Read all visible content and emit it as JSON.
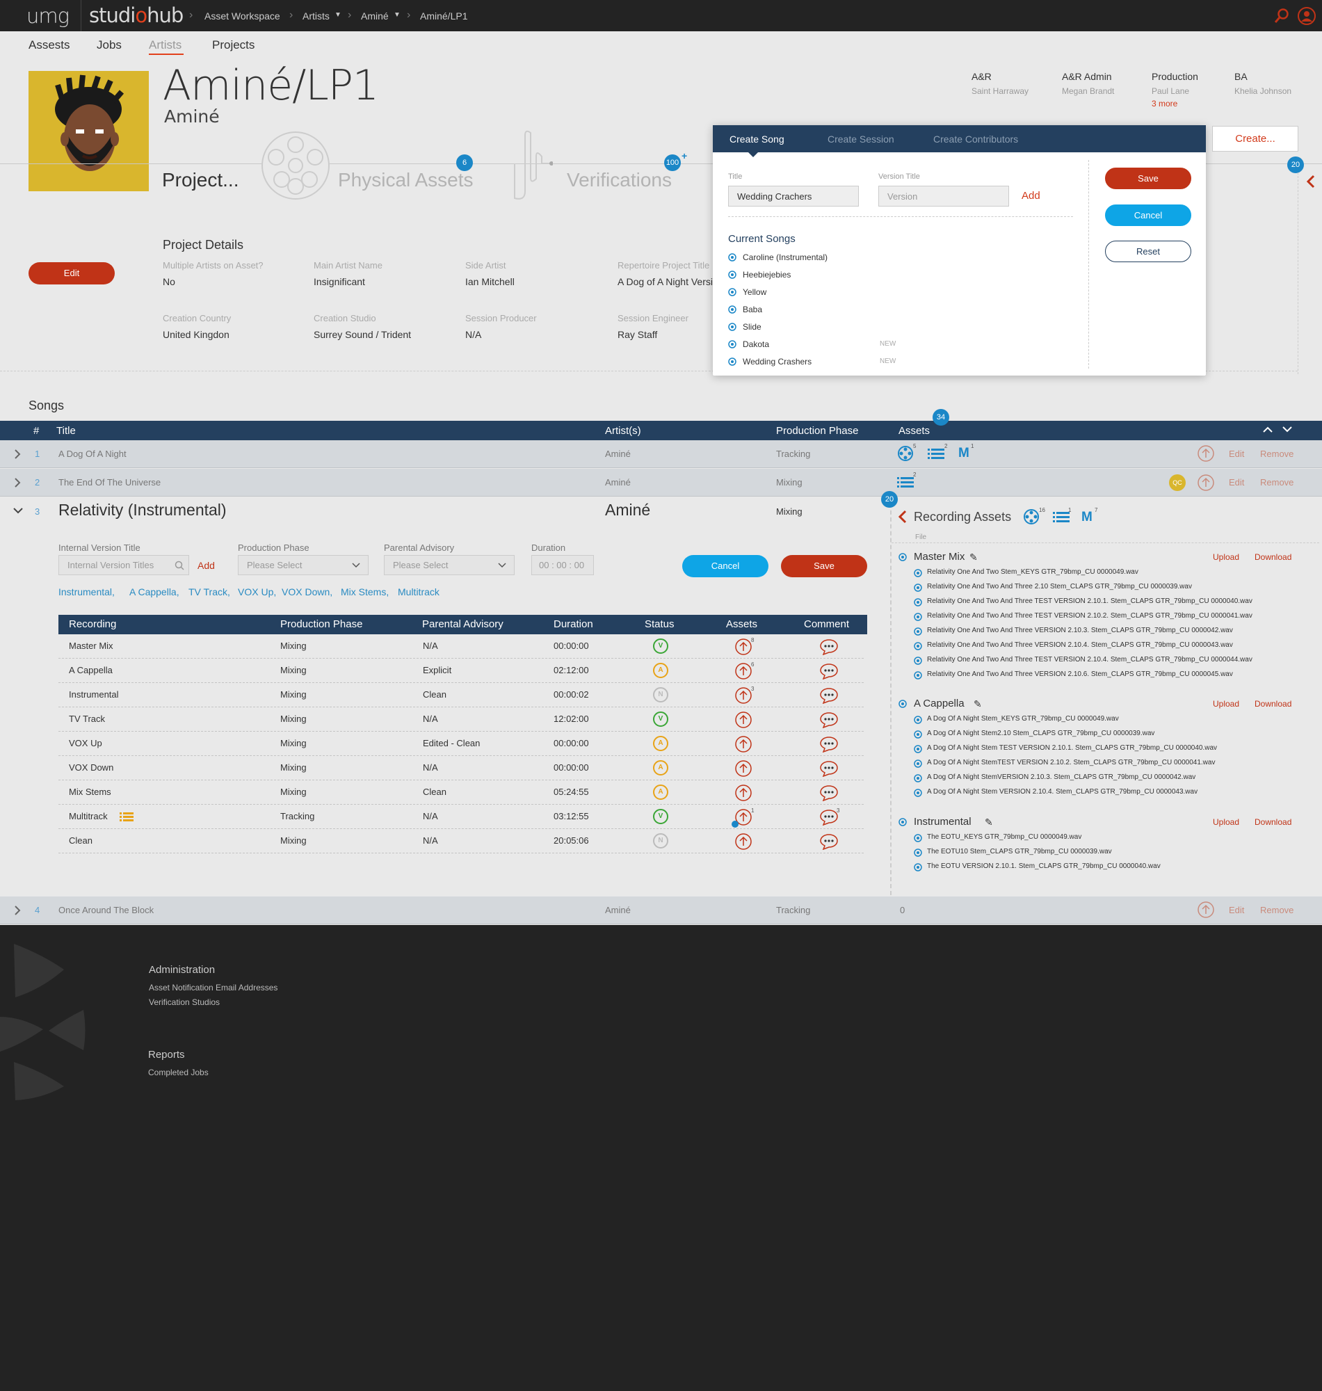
{
  "topbar": {
    "logo_left": "umg",
    "logo_right_a": "studi",
    "logo_right_o": "o",
    "logo_right_b": "hub",
    "breadcrumb": [
      "Asset Workspace",
      "Artists",
      "Aminé",
      "Aminé/LP1"
    ]
  },
  "nav": {
    "items": [
      "Assests",
      "Jobs",
      "Artists",
      "Projects"
    ],
    "active": "Artists"
  },
  "project": {
    "title": "Aminé/LP1",
    "artist": "Aminé"
  },
  "team": [
    {
      "role": "A&R",
      "name": "Saint Harraway"
    },
    {
      "role": "A&R Admin",
      "name": "Megan Brandt"
    },
    {
      "role": "Production",
      "name": "Paul Lane",
      "more": "3 more"
    },
    {
      "role": "BA",
      "name": "Khelia Johnson"
    }
  ],
  "stages": {
    "project": "Project...",
    "physical_assets": "Physical Assets",
    "physical_assets_count": "6",
    "verifications": "Verifications",
    "verifications_count": "100",
    "verifications_plus": "+",
    "right_count": "20"
  },
  "create_button": "Create...",
  "project_details": {
    "title": "Project Details",
    "edit": "Edit",
    "fields": [
      {
        "label": "Multiple Artists on Asset?",
        "value": "No"
      },
      {
        "label": "Main Artist Name",
        "value": "Insignificant"
      },
      {
        "label": "Side Artist",
        "value": "Ian Mitchell"
      },
      {
        "label": "Repertoire Project Title",
        "value": "A Dog of A Night Version"
      },
      {
        "label": "Creation Country",
        "value": "United Kingdon"
      },
      {
        "label": "Creation Studio",
        "value": "Surrey Sound / Trident"
      },
      {
        "label": "Session Producer",
        "value": "N/A"
      },
      {
        "label": "Session Engineer",
        "value": "Ray Staff"
      }
    ]
  },
  "songs": {
    "title": "Songs",
    "assets_count": "34",
    "headers": [
      "#",
      "Title",
      "Artist(s)",
      "Production Phase",
      "Assets"
    ],
    "actions": {
      "edit": "Edit",
      "remove": "Remove"
    },
    "rows": [
      {
        "num": "1",
        "title": "A Dog Of A Night",
        "artist": "Aminé",
        "phase": "Tracking"
      },
      {
        "num": "2",
        "title": "The End Of The Universe",
        "artist": "Aminé",
        "phase": "Mixing"
      },
      {
        "num": "3",
        "title": "Relativity (Instrumental)",
        "artist": "Aminé",
        "phase": "Mixing"
      },
      {
        "num": "4",
        "title": "Once Around The Block",
        "artist": "Aminé",
        "phase": "Tracking",
        "assets": "0"
      }
    ],
    "row1_badges": [
      "5",
      "2",
      "1"
    ],
    "row2_badges": [
      "2"
    ],
    "qc": "QC"
  },
  "expanded": {
    "internal_label": "Internal Version Title",
    "internal_placeholder": "Internal Version Titles",
    "add": "Add",
    "phase_label": "Production Phase",
    "phase_value": "Please Select",
    "advisory_label": "Parental Advisory",
    "advisory_value": "Please Select",
    "duration_label": "Duration",
    "duration_value": "00 : 00 : 00",
    "cancel": "Cancel",
    "save": "Save",
    "chips": [
      "Instrumental,",
      "A Cappella,",
      "TV Track,",
      "VOX Up,",
      "VOX Down,",
      "Mix Stems,",
      "Multitrack"
    ],
    "rec_headers": [
      "Recording",
      "Production Phase",
      "Parental Advisory",
      "Duration",
      "Status",
      "Assets",
      "Comment"
    ],
    "recordings": [
      {
        "name": "Master Mix",
        "phase": "Mixing",
        "advisory": "N/A",
        "duration": "00:00:00",
        "status": "V",
        "asset_badge": "8"
      },
      {
        "name": "A Cappella",
        "phase": "Mixing",
        "advisory": "Explicit",
        "duration": "02:12:00",
        "status": "A",
        "asset_badge": "6"
      },
      {
        "name": "Instrumental",
        "phase": "Mixing",
        "advisory": "Clean",
        "duration": "00:00:02",
        "status": "N",
        "asset_badge": "3"
      },
      {
        "name": "TV Track",
        "phase": "Mixing",
        "advisory": "N/A",
        "duration": "12:02:00",
        "status": "V",
        "asset_badge": ""
      },
      {
        "name": "VOX Up",
        "phase": "Mixing",
        "advisory": "Edited - Clean",
        "duration": "00:00:00",
        "status": "A",
        "asset_badge": ""
      },
      {
        "name": "VOX Down",
        "phase": "Mixing",
        "advisory": "N/A",
        "duration": "00:00:00",
        "status": "A",
        "asset_badge": ""
      },
      {
        "name": "Mix Stems",
        "phase": "Mixing",
        "advisory": "Clean",
        "duration": "05:24:55",
        "status": "A",
        "asset_badge": ""
      },
      {
        "name": "Multitrack",
        "phase": "Tracking",
        "advisory": "N/A",
        "duration": "03:12:55",
        "status": "V",
        "asset_badge": "1",
        "comment_badge": "3"
      },
      {
        "name": "Clean",
        "phase": "Mixing",
        "advisory": "N/A",
        "duration": "20:05:06",
        "status": "N",
        "asset_badge": ""
      }
    ]
  },
  "recording_assets": {
    "title": "Recording Assets",
    "count": "20",
    "file_label": "File",
    "badges": [
      "16",
      "1",
      "7"
    ],
    "upload": "Upload",
    "download": "Download",
    "sections": [
      {
        "name": "Master Mix",
        "files": [
          "Relativity One And Two Stem_KEYS GTR_79bmp_CU 0000049.wav",
          "Relativity One And Two And Three 2.10 Stem_CLAPS GTR_79bmp_CU 0000039.wav",
          "Relativity One And Two And Three TEST VERSION 2.10.1. Stem_CLAPS GTR_79bmp_CU 0000040.wav",
          "Relativity One And Two And Three TEST VERSION 2.10.2. Stem_CLAPS GTR_79bmp_CU 0000041.wav",
          "Relativity One And Two And Three VERSION 2.10.3. Stem_CLAPS GTR_79bmp_CU 0000042.wav",
          "Relativity One And Two And Three VERSION 2.10.4. Stem_CLAPS GTR_79bmp_CU 0000043.wav",
          "Relativity One And Two And Three TEST VERSION 2.10.4. Stem_CLAPS GTR_79bmp_CU 0000044.wav",
          "Relativity One And Two And Three VERSION 2.10.6. Stem_CLAPS GTR_79bmp_CU 0000045.wav"
        ]
      },
      {
        "name": "A Cappella",
        "files": [
          "A Dog Of A Night Stem_KEYS GTR_79bmp_CU 0000049.wav",
          "A Dog Of A Night Stem2.10 Stem_CLAPS GTR_79bmp_CU 0000039.wav",
          "A Dog Of A Night Stem TEST VERSION 2.10.1. Stem_CLAPS GTR_79bmp_CU 0000040.wav",
          "A Dog Of A Night StemTEST VERSION 2.10.2. Stem_CLAPS GTR_79bmp_CU 0000041.wav",
          "A Dog Of A Night StemVERSION 2.10.3. Stem_CLAPS GTR_79bmp_CU 0000042.wav",
          "A Dog Of A Night Stem VERSION 2.10.4. Stem_CLAPS GTR_79bmp_CU 0000043.wav"
        ]
      },
      {
        "name": "Instrumental",
        "files": [
          "The EOTU_KEYS GTR_79bmp_CU 0000049.wav",
          "The EOTU10 Stem_CLAPS GTR_79bmp_CU 0000039.wav",
          "The EOTU VERSION 2.10.1. Stem_CLAPS GTR_79bmp_CU 0000040.wav"
        ]
      }
    ]
  },
  "modal": {
    "tabs": [
      "Create Song",
      "Create Session",
      "Create Contributors"
    ],
    "title_label": "Title",
    "title_value": "Wedding Crachers",
    "version_label": "Version Title",
    "version_placeholder": "Version",
    "add": "Add",
    "current_songs_title": "Current Songs",
    "songs": [
      {
        "name": "Caroline (Instrumental)",
        "tag": ""
      },
      {
        "name": "Heebiejebies",
        "tag": ""
      },
      {
        "name": "Yellow",
        "tag": ""
      },
      {
        "name": "Baba",
        "tag": ""
      },
      {
        "name": "Slide",
        "tag": ""
      },
      {
        "name": "Dakota",
        "tag": "NEW"
      },
      {
        "name": "Wedding Crashers",
        "tag": "NEW"
      }
    ],
    "save": "Save",
    "cancel": "Cancel",
    "reset": "Reset"
  },
  "footer": {
    "admin_title": "Administration",
    "admin_links": [
      "Asset Notification Email Addresses",
      "Verification Studios"
    ],
    "reports_title": "Reports",
    "report_links": [
      "Completed Jobs"
    ]
  },
  "colors": {
    "navy": "#24405f",
    "accent_red": "#c03317",
    "blue": "#1b87c7",
    "cyan": "#0ea5e6",
    "status_v": "#3aa636",
    "status_a": "#e8a317",
    "status_n": "#bbbbbb"
  }
}
